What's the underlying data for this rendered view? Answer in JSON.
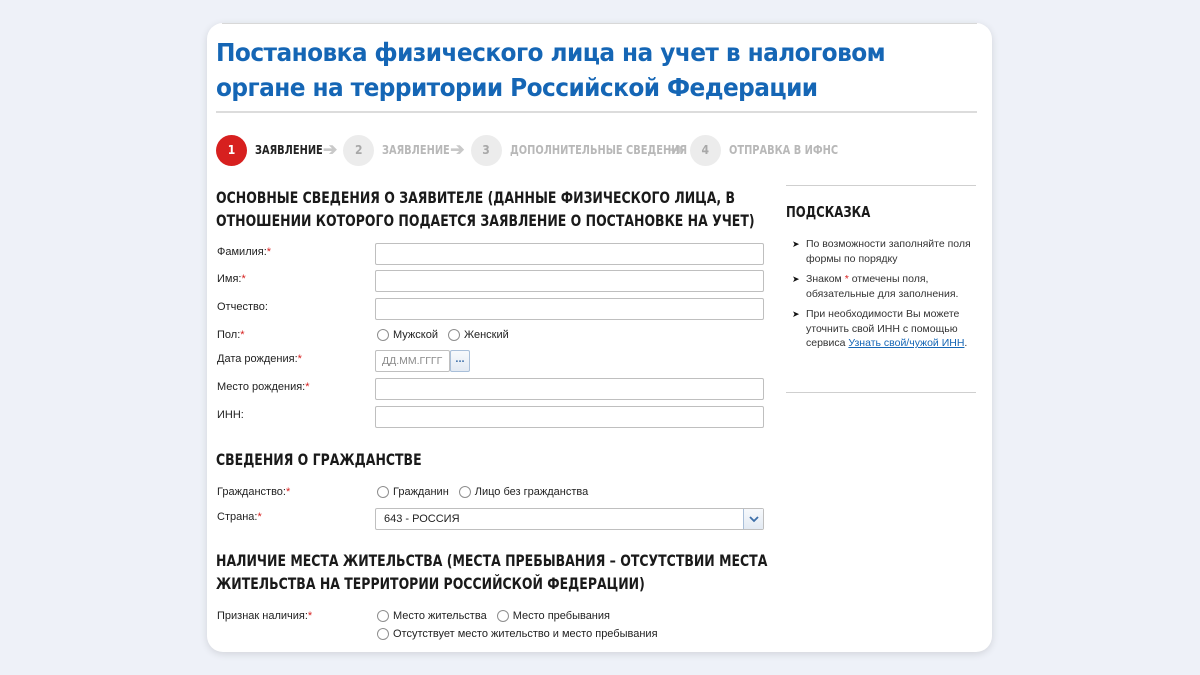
{
  "page_title": "Постановка физического лица на учет в налоговом органе на территории Российской Федерации",
  "steps": [
    {
      "number": "1",
      "label": "ЗАЯВЛЕНИЕ",
      "active": true
    },
    {
      "number": "2",
      "label": "ЗАЯВЛЕНИЕ",
      "active": false
    },
    {
      "number": "3",
      "label": "ДОПОЛНИТЕЛЬНЫЕ СВЕДЕНИЯ",
      "active": false
    },
    {
      "number": "4",
      "label": "ОТПРАВКА В ИФНС",
      "active": false
    }
  ],
  "applicant": {
    "title_line1": "ОСНОВНЫЕ СВЕДЕНИЯ О ЗАЯВИТЕЛЕ (ДАННЫЕ ФИЗИЧЕСКОГО ЛИЦА, В",
    "title_line2": "ОТНОШЕНИИ КОТОРОГО ПОДАЕТСЯ ЗАЯВЛЕНИЕ О ПОСТАНОВКЕ НА УЧЕТ)",
    "surname_label": "Фамилия:",
    "name_label": "Имя:",
    "patronymic_label": "Отчество:",
    "gender_label": "Пол:",
    "gender_male": "Мужской",
    "gender_female": "Женский",
    "birthdate_label": "Дата рождения:",
    "birthdate_placeholder": "ДД.ММ.ГГГГ",
    "birthdate_btn": "...",
    "birthplace_label": "Место рождения:",
    "inn_label": "ИНН:",
    "required_mark": "*"
  },
  "citizenship": {
    "title": "СВЕДЕНИЯ О ГРАЖДАНСТВЕ",
    "citizenship_label": "Гражданство:",
    "option_citizen": "Гражданин",
    "option_stateless": "Лицо без гражданства",
    "country_label": "Страна:",
    "country_value": "643 - РОССИЯ"
  },
  "residence": {
    "title_line1": "НАЛИЧИЕ МЕСТА ЖИТЕЛЬСТВА (МЕСТА ПРЕБЫВАНИЯ – ОТСУТСТВИИ МЕСТА",
    "title_line2": "ЖИТЕЛЬСТВА НА ТЕРРИТОРИИ РОССИЙСКОЙ ФЕДЕРАЦИИ)",
    "sign_label": "Признак наличия:",
    "option_residence": "Место жительства",
    "option_stay": "Место пребывания",
    "option_none": "Отсутствует место жительство и место пребывания"
  },
  "hint": {
    "title": "ПОДСКАЗКА",
    "item1": "По возможности заполняйте поля формы по порядку",
    "item2_prefix": "Знаком",
    "item2_mark": "*",
    "item2_suffix": "отмечены поля, обязательные для заполнения.",
    "item3_text": "При необходимости Вы можете уточнить свой ИНН с помощью сервиса",
    "item3_link": "Узнать свой/чужой ИНН",
    "item3_end": "."
  }
}
